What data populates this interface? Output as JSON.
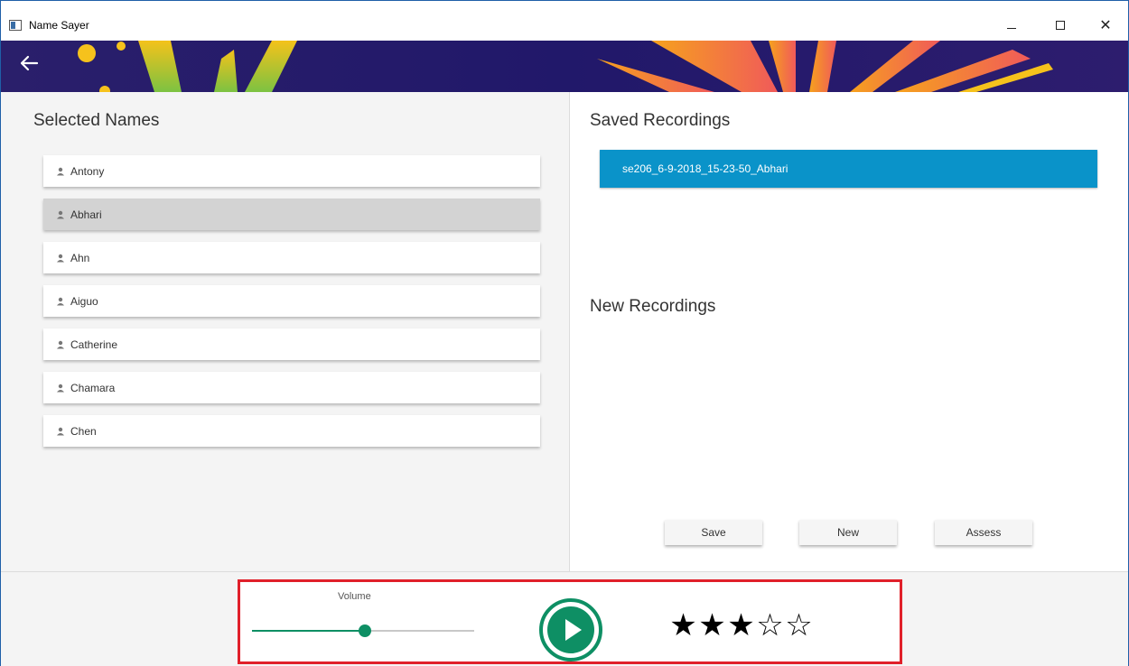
{
  "window": {
    "title": "Name Sayer",
    "minimize_icon": "minimize-icon",
    "maximize_icon": "maximize-icon",
    "close_label": "✕"
  },
  "header": {
    "back_icon": "arrow-left-icon"
  },
  "selected_names": {
    "title": "Selected Names",
    "items": [
      {
        "label": "Antony",
        "selected": false
      },
      {
        "label": "Abhari",
        "selected": true
      },
      {
        "label": "Ahn",
        "selected": false
      },
      {
        "label": "Aiguo",
        "selected": false
      },
      {
        "label": "Catherine",
        "selected": false
      },
      {
        "label": "Chamara",
        "selected": false
      },
      {
        "label": "Chen",
        "selected": false
      }
    ]
  },
  "saved_recordings": {
    "title": "Saved Recordings",
    "items": [
      {
        "label": "se206_6-9-2018_15-23-50_Abhari",
        "selected": true
      }
    ]
  },
  "new_recordings": {
    "title": "New Recordings"
  },
  "actions": {
    "save_label": "Save",
    "new_label": "New",
    "assess_label": "Assess"
  },
  "player": {
    "volume_label": "Volume",
    "volume_fraction": 0.5,
    "play_icon": "play-icon",
    "rating": 3,
    "rating_max": 5,
    "filled_star": "★",
    "empty_star": "☆"
  },
  "colors": {
    "accent_green": "#0e8f64",
    "selection_blue": "#0a93c9",
    "highlight_red": "#e0202a",
    "banner_purple": "#21186a"
  }
}
